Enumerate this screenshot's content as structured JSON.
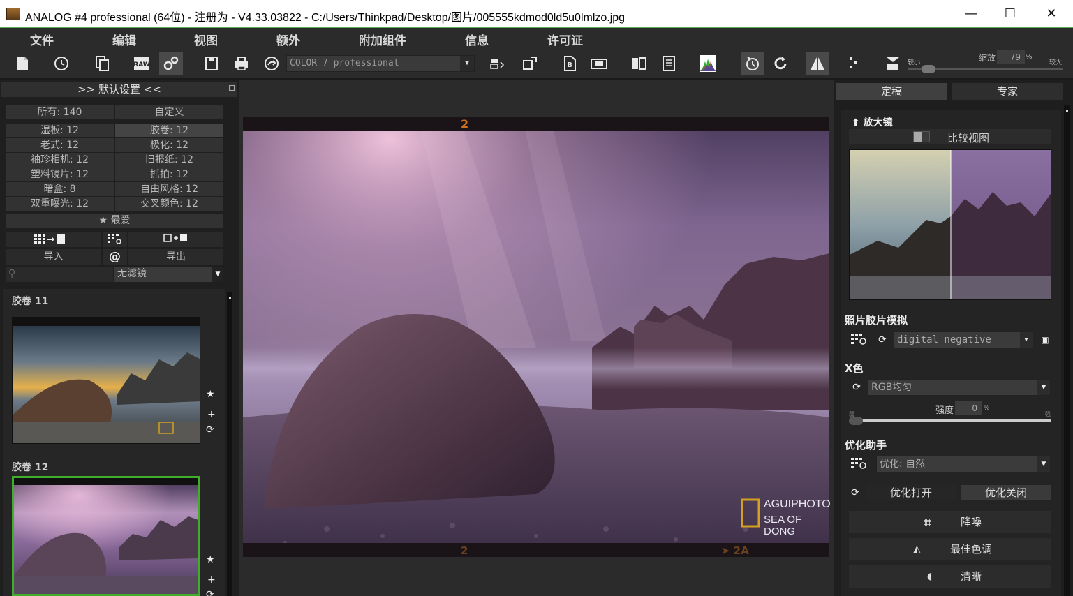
{
  "window": {
    "title": "ANALOG #4 professional (64位) - 注册为 - V4.33.03822 - C:/Users/Thinkpad/Desktop/图片/005555kdmod0ld5u0lmlzo.jpg",
    "minimize": "—",
    "maximize": "☐",
    "close": "✕"
  },
  "menu": [
    "文件",
    "编辑",
    "视图",
    "额外",
    "附加组件",
    "信息",
    "许可证"
  ],
  "toolbar": {
    "profile_combo": "COLOR 7 professional",
    "zoom_label": "缩放",
    "zoom_value": "79",
    "zoom_unit": "%",
    "zoom_min": "较小",
    "zoom_max": "较大",
    "zoom_level": 0.1
  },
  "left": {
    "header": ">> 默认设置 <<",
    "categories": [
      [
        "所有: 140",
        "自定义"
      ],
      [
        "湿板: 12",
        "胶卷: 12"
      ],
      [
        "老式: 12",
        "极化: 12"
      ],
      [
        "袖珍相机: 12",
        "旧报纸: 12"
      ],
      [
        "塑料镜片: 12",
        "抓拍: 12"
      ],
      [
        "暗盒: 8",
        "自由风格: 12"
      ],
      [
        "双重曝光: 12",
        "交叉颜色: 12"
      ]
    ],
    "favorites": "★ 最爱",
    "import": "导入",
    "at": "@",
    "export": "导出",
    "filter_value": "无滤镜",
    "thumbs": [
      {
        "title": "胶卷  11",
        "selected": false
      },
      {
        "title": "胶卷  12",
        "selected": true
      }
    ]
  },
  "photo": {
    "frame_top": "2",
    "frame_bottom_left": "2",
    "frame_bottom_right": "➤ 2A",
    "watermark_line1": "AGUIPHOTO",
    "watermark_line2": "SEA OF DONG"
  },
  "right": {
    "tabs": [
      "定稿",
      "专家"
    ],
    "magnifier": "放大镜",
    "compare": "比较视图",
    "film_section": "照片胶片模拟",
    "film_value": "digital negative",
    "color_section": "X色",
    "color_value": "RGB均匀",
    "strength_label": "强度",
    "strength_value": "0",
    "strength_unit": "%",
    "strength_min": "弱",
    "strength_max": "强",
    "optimize_section": "优化助手",
    "optimize_value": "优化: 自然",
    "optimize_on": "优化打开",
    "optimize_off": "优化关闭",
    "actions": [
      "降噪",
      "最佳色调",
      "清晰"
    ]
  },
  "colors": {
    "accent_green": "#3fae2a",
    "frame_text": "#d0701f"
  }
}
